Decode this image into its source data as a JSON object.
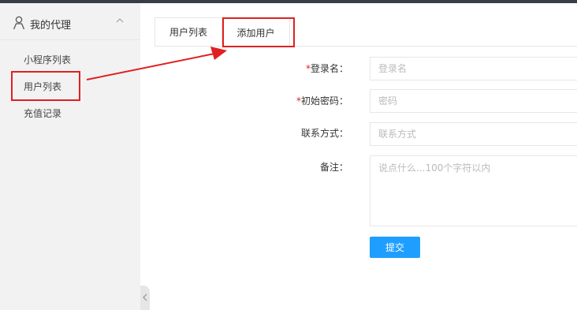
{
  "sidebar": {
    "title": "我的代理",
    "icon": "user-icon",
    "collapse_icon": "chevron-up-icon",
    "items": [
      {
        "label": "小程序列表"
      },
      {
        "label": "用户列表"
      },
      {
        "label": "充值记录"
      }
    ]
  },
  "tabs": [
    {
      "label": "用户列表"
    },
    {
      "label": "添加用户"
    }
  ],
  "form": {
    "fields": [
      {
        "required_mark": "*",
        "label": "登录名：",
        "placeholder": "登录名"
      },
      {
        "required_mark": "*",
        "label": "初始密码：",
        "placeholder": "密码"
      },
      {
        "required_mark": "",
        "label": "联系方式：",
        "placeholder": "联系方式"
      }
    ],
    "remark": {
      "label": "备注：",
      "placeholder": "说点什么...100个字符以内"
    },
    "submit_label": "提交"
  },
  "colors": {
    "accent": "#1e9fff",
    "annotation": "#e02020",
    "sidebar_bg": "#f2f2f2",
    "topbar": "#393d49"
  }
}
